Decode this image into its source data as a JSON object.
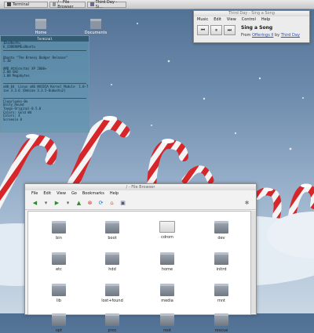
{
  "taskbar": {
    "items": [
      {
        "label": "Terminal"
      },
      {
        "label": "/ - File Browser"
      },
      {
        "label": "Third Day - Si..."
      }
    ]
  },
  "desktop": {
    "icons": [
      {
        "label": "Home"
      },
      {
        "label": "Documents"
      }
    ]
  },
  "terminal": {
    "title": "Terminal",
    "lines": [
      "ID=Ubuntu",
      "E_CODENAME=Ubuntu",
      "",
      "Ubuntu \"The Breezy Badger Release\"",
      "5.10",
      "",
      "AMD Athlon(tm) XP 2800+",
      "2.08 GHz",
      "1.08 Megabytes",
      "",
      "x86_64  Linux x86 NVIDIA Kernel Module  1.0-7174  Tue Mar 22 06:44:28 PST 2005",
      "ion 3.3.6 (Debian 3.3.5-8ubuntu2)",
      "",
      "Clearlooks-Bo",
      "Unity_Round",
      "Tango-Original-0.5.0",
      "Colors: Gold Wd",
      "Colors: 4",
      "Screenie 0"
    ]
  },
  "music": {
    "window_title": "Third Day - Sing a Song",
    "menu": [
      "Music",
      "Edit",
      "View",
      "Control",
      "Help"
    ],
    "song_title": "Sing a Song",
    "from_label": "From",
    "album": "Offerings II",
    "by_label": "by",
    "artist": "Third Day",
    "buttons": {
      "prev": "⏮",
      "pause": "⏸",
      "next": "⏭"
    }
  },
  "filebrowser": {
    "title": "/ - File Browser",
    "menu": [
      "File",
      "Edit",
      "View",
      "Go",
      "Bookmarks",
      "Help"
    ],
    "files": [
      "bin",
      "boot",
      "cdrom",
      "dev",
      "etc",
      "hdd",
      "home",
      "initrd",
      "lib",
      "lost+found",
      "media",
      "mnt",
      "opt",
      "proc",
      "root",
      "rescue"
    ]
  }
}
